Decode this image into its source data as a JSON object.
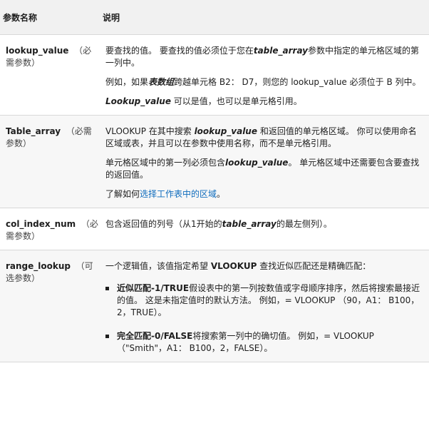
{
  "header": {
    "col1": "参数名称",
    "col2": "说明"
  },
  "rows": [
    {
      "name": "lookup_value",
      "req": "（必需参数）",
      "p1": {
        "a": "要查找的值。 要查找的值必须位于您在",
        "b": "table_array",
        "c": "参数中指定的单元格区域的第一列中。"
      },
      "p2": {
        "a": "例如，如果",
        "b": "表数组",
        "c": "跨越单元格 B2： D7，则您的 lookup_value 必须位于 B 列中。"
      },
      "p3": {
        "a": "Lookup_value",
        "b": " 可以是值，也可以是单元格引用。"
      }
    },
    {
      "name": "Table_array",
      "req": "（必需参数）",
      "p1": {
        "a": "VLOOKUP 在其中搜索 ",
        "b": "lookup_value",
        "c": " 和返回值的单元格区域。 你可以使用命名区域或表，并且可以在参数中使用名称，而不是单元格引用。"
      },
      "p2": {
        "a": "单元格区域中的第一列必须包含",
        "b": "lookup_value",
        "c": "。 单元格区域中还需要包含要查找的返回值。"
      },
      "p3": {
        "a": "了解如何",
        "link": "选择工作表中的区域",
        "c": "。"
      }
    },
    {
      "name": "col_index_num",
      "req": "（必需参数）",
      "p1": {
        "a": "包含返回值的列号（从1开始的",
        "b": "table_array",
        "c": "的最左侧列）。"
      }
    },
    {
      "name": "range_lookup",
      "req": "（可选参数）",
      "p1": {
        "a": "一个逻辑值，该值指定希望 ",
        "b": "VLOOKUP",
        "c": " 查找近似匹配还是精确匹配："
      },
      "bullets": [
        {
          "b": "近似匹配-1/TRUE",
          "c": "假设表中的第一列按数值或字母顺序排序，然后将搜索最接近的值。 这是未指定值时的默认方法。 例如，= VLOOKUP （90，A1： B100，2，TRUE）。"
        },
        {
          "b": "完全匹配-0/FALSE",
          "c": "将搜索第一列中的确切值。 例如，= VLOOKUP （\"Smith\"，A1： B100，2，FALSE）。"
        }
      ]
    }
  ]
}
